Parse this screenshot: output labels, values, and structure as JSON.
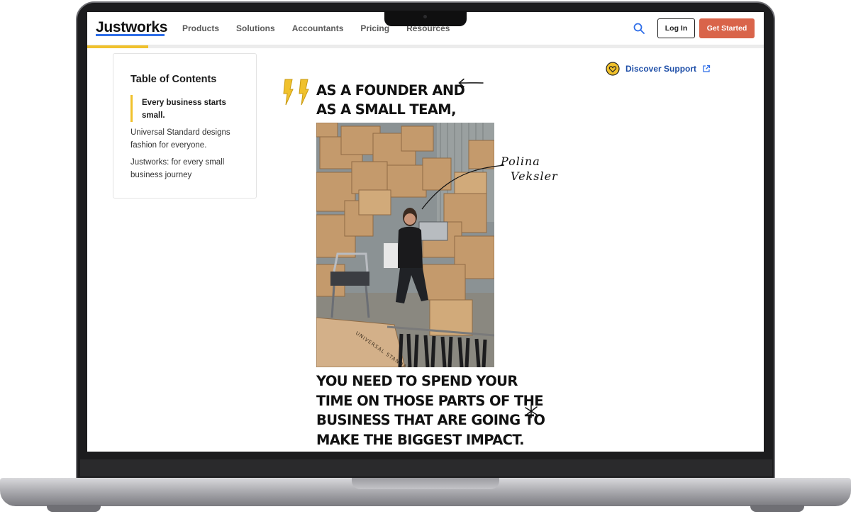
{
  "nav": {
    "logo": "Justworks",
    "links": [
      "Products",
      "Solutions",
      "Accountants",
      "Pricing",
      "Resources"
    ],
    "login_label": "Log In",
    "get_started_label": "Get Started",
    "reading_progress": 0.09
  },
  "toc": {
    "title": "Table of Contents",
    "items": [
      "Every business starts small.",
      "Universal Standard designs fashion for everyone.",
      "Justworks: for every small business journey"
    ]
  },
  "support": {
    "label": "Discover Support"
  },
  "quote": {
    "top_line1": "AS A FOUNDER AND",
    "top_line2": "AS A SMALL TEAM,",
    "bottom_line1": "YOU NEED TO SPEND YOUR",
    "bottom_line2": "TIME ON THOSE PARTS OF THE",
    "bottom_line3": "BUSINESS THAT ARE GOING TO",
    "bottom_line4": "MAKE THE BIGGEST IMPACT."
  },
  "annotation": {
    "first_name": "Polina",
    "last_name": "Veksler"
  },
  "photo": {
    "box_print": "UNIVERSAL STANDARD"
  },
  "colors": {
    "accent_orange": "#d9644a",
    "highlight_yellow": "#f0c12c",
    "link_blue": "#1f4fa8",
    "logo_underline": "#2f6ee8"
  }
}
